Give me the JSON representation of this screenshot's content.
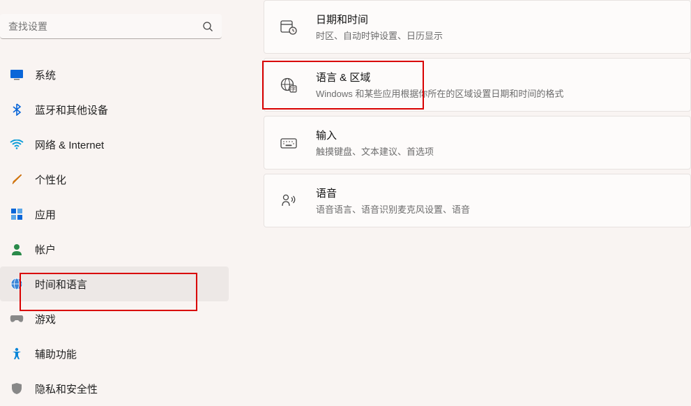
{
  "search": {
    "placeholder": "查找设置"
  },
  "nav": [
    {
      "label": "系统"
    },
    {
      "label": "蓝牙和其他设备"
    },
    {
      "label": "网络 & Internet"
    },
    {
      "label": "个性化"
    },
    {
      "label": "应用"
    },
    {
      "label": "帐户"
    },
    {
      "label": "时间和语言"
    },
    {
      "label": "游戏"
    },
    {
      "label": "辅助功能"
    },
    {
      "label": "隐私和安全性"
    }
  ],
  "cards": [
    {
      "title": "日期和时间",
      "sub": "时区、自动时钟设置、日历显示"
    },
    {
      "title": "语言 & 区域",
      "sub": "Windows 和某些应用根据你所在的区域设置日期和时间的格式"
    },
    {
      "title": "输入",
      "sub": "触摸键盘、文本建议、首选项"
    },
    {
      "title": "语音",
      "sub": "语音语言、语音识别麦克风设置、语音"
    }
  ]
}
